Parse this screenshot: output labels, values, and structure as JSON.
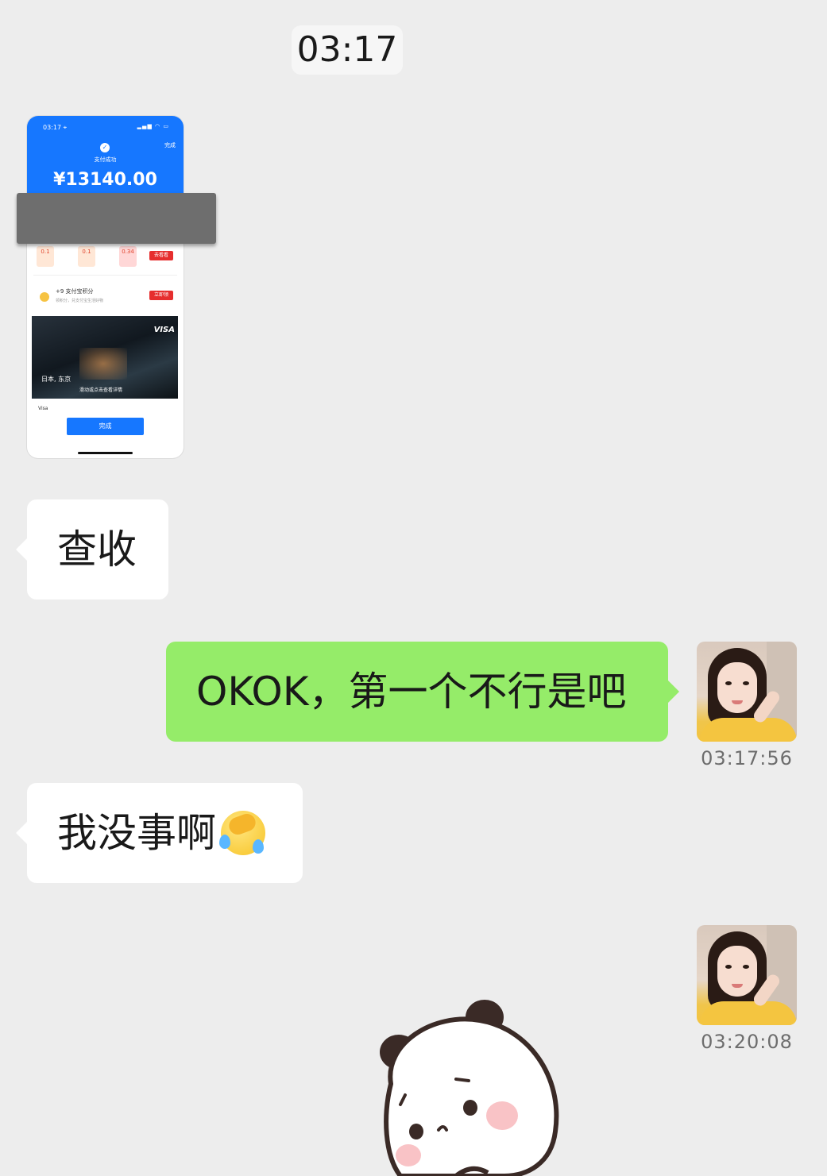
{
  "time_divider": "03:17",
  "image_message": {
    "status_time": "03:17 ⌖",
    "status_icons": "▂▄▆ ◠ ▭",
    "done_top": "完成",
    "check": "✓",
    "success_text": "支付成功",
    "amount": "¥13140.00",
    "chip_values": [
      "0.1",
      "0.1",
      "0.34"
    ],
    "red_btn_1": "去看看",
    "points_text": "+9 支付宝积分",
    "points_sub": "领积分，兑支付宝生活好物",
    "red_btn_2": "立即领",
    "promo_brand": "VISA",
    "promo_city": "日本, 东京",
    "promo_caption": "滑动或点击查看详情",
    "visa_row": "Visa",
    "done_button": "完成"
  },
  "messages": [
    {
      "side": "left",
      "text": "查收"
    },
    {
      "side": "right",
      "text": "OKOK，第一个不行是吧",
      "timestamp": "03:17:56"
    },
    {
      "side": "left",
      "text": "我没事啊",
      "emoji": "laughing-crying-emoji"
    },
    {
      "side": "right",
      "sticker": "panda-sticker",
      "timestamp": "03:20:08"
    }
  ],
  "colors": {
    "background": "#ededed",
    "bubble_self": "#95ec69",
    "bubble_other": "#ffffff",
    "alipay_blue": "#1677ff"
  }
}
